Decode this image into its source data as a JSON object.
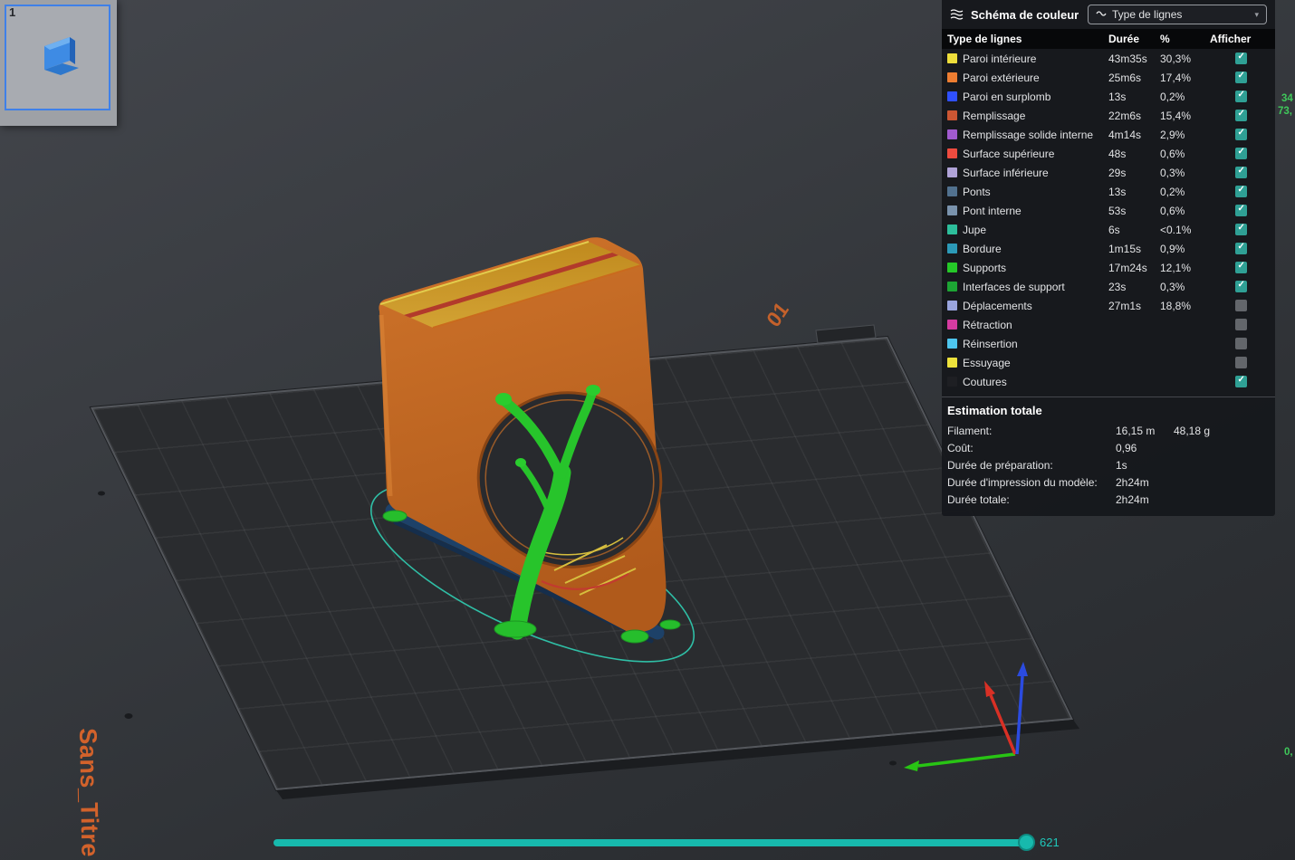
{
  "thumbnail": {
    "plate_number": "1"
  },
  "viewport": {
    "plate_title": "Sans_Titre",
    "plate_corner_label": "01",
    "slider_value": "621",
    "edge_labels": {
      "top_1": "34",
      "top_2": "73,",
      "bottom": "0,"
    }
  },
  "panel": {
    "title": "Schéma de couleur",
    "dropdown_value": "Type de lignes",
    "table": {
      "headers": {
        "type": "Type de lignes",
        "duration": "Durée",
        "percent": "%",
        "show": "Afficher"
      },
      "rows": [
        {
          "label": "Paroi intérieure",
          "color": "#EEDE3B",
          "duration": "43m35s",
          "percent": "30,3%",
          "checked": true
        },
        {
          "label": "Paroi extérieure",
          "color": "#ED7D31",
          "duration": "25m6s",
          "percent": "17,4%",
          "checked": true
        },
        {
          "label": "Paroi en surplomb",
          "color": "#2F50FF",
          "duration": "13s",
          "percent": "0,2%",
          "checked": true
        },
        {
          "label": "Remplissage",
          "color": "#CC5633",
          "duration": "22m6s",
          "percent": "15,4%",
          "checked": true
        },
        {
          "label": "Remplissage solide interne",
          "color": "#A15ACF",
          "duration": "4m14s",
          "percent": "2,9%",
          "checked": true
        },
        {
          "label": "Surface supérieure",
          "color": "#EE4B3F",
          "duration": "48s",
          "percent": "0,6%",
          "checked": true
        },
        {
          "label": "Surface inférieure",
          "color": "#B0A3D8",
          "duration": "29s",
          "percent": "0,3%",
          "checked": true
        },
        {
          "label": "Ponts",
          "color": "#51718F",
          "duration": "13s",
          "percent": "0,2%",
          "checked": true
        },
        {
          "label": "Pont interne",
          "color": "#7A93AD",
          "duration": "53s",
          "percent": "0,6%",
          "checked": true
        },
        {
          "label": "Jupe",
          "color": "#2DBE9B",
          "duration": "6s",
          "percent": "<0.1%",
          "checked": true
        },
        {
          "label": "Bordure",
          "color": "#2C9AB8",
          "duration": "1m15s",
          "percent": "0,9%",
          "checked": true
        },
        {
          "label": "Supports",
          "color": "#25C828",
          "duration": "17m24s",
          "percent": "12,1%",
          "checked": true
        },
        {
          "label": "Interfaces de support",
          "color": "#1DA434",
          "duration": "23s",
          "percent": "0,3%",
          "checked": true
        },
        {
          "label": "Déplacements",
          "color": "#9AA5DE",
          "duration": "27m1s",
          "percent": "18,8%",
          "checked": false
        },
        {
          "label": "Rétraction",
          "color": "#D53BA0",
          "duration": "",
          "percent": "",
          "checked": false
        },
        {
          "label": "Réinsertion",
          "color": "#4EC6EE",
          "duration": "",
          "percent": "",
          "checked": false
        },
        {
          "label": "Essuyage",
          "color": "#EDE23C",
          "duration": "",
          "percent": "",
          "checked": false
        },
        {
          "label": "Coutures",
          "color": "#1E1F23",
          "duration": "",
          "percent": "",
          "checked": true
        }
      ]
    },
    "estimation": {
      "title": "Estimation totale",
      "rows": [
        {
          "label": "Filament:",
          "value": "16,15 m",
          "value2": "48,18 g"
        },
        {
          "label": "Coût:",
          "value": "0,96",
          "value2": ""
        },
        {
          "label": "Durée de préparation:",
          "value": "1s",
          "value2": ""
        },
        {
          "label": "Durée d'impression du modèle:",
          "value": "2h24m",
          "value2": ""
        },
        {
          "label": "Durée totale:",
          "value": "2h24m",
          "value2": ""
        }
      ]
    }
  }
}
